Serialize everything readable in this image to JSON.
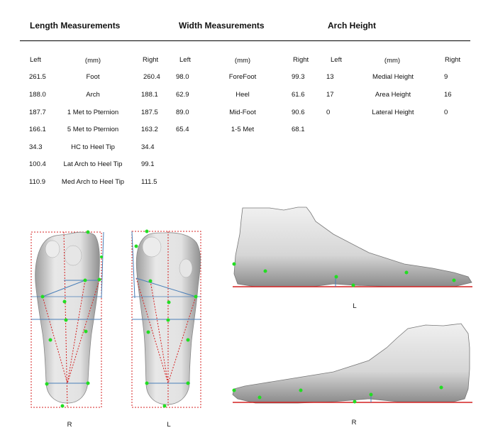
{
  "headers": {
    "length": "Length Measurements",
    "width": "Width Measurements",
    "arch": "Arch Height"
  },
  "columns": {
    "left": "Left",
    "right": "Right",
    "unit": "(mm)"
  },
  "length_rows": [
    {
      "left": "261.5",
      "label": "Foot",
      "right": "260.4"
    },
    {
      "left": "188.0",
      "label": "Arch",
      "right": "188.1"
    },
    {
      "left": "187.7",
      "label": "1 Met to Pternion",
      "right": "187.5"
    },
    {
      "left": "166.1",
      "label": "5 Met to Pternion",
      "right": "163.2"
    },
    {
      "left": "34.3",
      "label": "HC to Heel Tip",
      "right": "34.4"
    },
    {
      "left": "100.4",
      "label": "Lat Arch to Heel Tip",
      "right": "99.1"
    },
    {
      "left": "110.9",
      "label": "Med Arch to Heel Tip",
      "right": "111.5"
    }
  ],
  "width_rows": [
    {
      "left": "98.0",
      "label": "ForeFoot",
      "right": "99.3"
    },
    {
      "left": "62.9",
      "label": "Heel",
      "right": "61.6"
    },
    {
      "left": "89.0",
      "label": "Mid-Foot",
      "right": "90.6"
    },
    {
      "left": "65.4",
      "label": "1-5 Met",
      "right": "68.1"
    }
  ],
  "arch_rows": [
    {
      "left": "13",
      "label": "Medial Height",
      "right": "9"
    },
    {
      "left": "17",
      "label": "Area Height",
      "right": "16"
    },
    {
      "left": "0",
      "label": "Lateral Height",
      "right": "0"
    }
  ],
  "image_labels": {
    "plantar_right": "R",
    "plantar_left": "L",
    "side_left": "L",
    "side_right": "R"
  },
  "colors": {
    "guide_red": "#d42020",
    "guide_blue": "#4a7fb8",
    "marker_green": "#22dd22",
    "foot_fill": "#d2d2d2"
  }
}
